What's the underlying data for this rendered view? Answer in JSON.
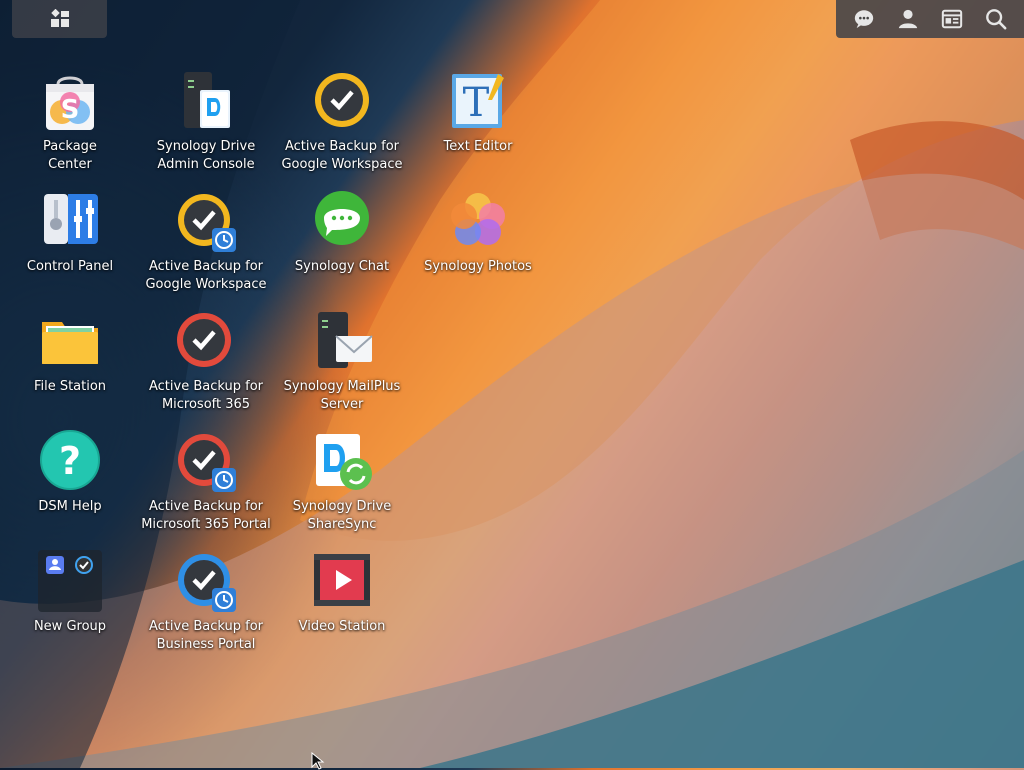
{
  "taskbar": {
    "main_menu_icon": "grid-icon",
    "tray": [
      {
        "name": "chat-icon"
      },
      {
        "name": "user-icon"
      },
      {
        "name": "widgets-icon"
      },
      {
        "name": "search-icon"
      }
    ]
  },
  "desktop": {
    "icons": [
      {
        "label": "Package\nCenter",
        "icon": "package-center-icon"
      },
      {
        "label": "Control Panel",
        "icon": "control-panel-icon"
      },
      {
        "label": "File Station",
        "icon": "file-station-icon"
      },
      {
        "label": "DSM Help",
        "icon": "dsm-help-icon"
      },
      {
        "label": "New Group",
        "icon": "new-group-icon"
      },
      {
        "label": "Synology Drive\nAdmin Console",
        "icon": "drive-admin-console-icon"
      },
      {
        "label": "Active Backup for\nGoogle Workspace",
        "icon": "active-backup-google-portal-icon"
      },
      {
        "label": "Active Backup for\nMicrosoft 365",
        "icon": "active-backup-m365-icon"
      },
      {
        "label": "Active Backup for\nMicrosoft 365 Portal",
        "icon": "active-backup-m365-portal-icon"
      },
      {
        "label": "Active Backup for\nBusiness Portal",
        "icon": "active-backup-business-portal-icon"
      },
      {
        "label": "Active Backup for\nGoogle Workspace",
        "icon": "active-backup-google-icon"
      },
      {
        "label": "Synology Chat",
        "icon": "synology-chat-icon"
      },
      {
        "label": "Synology MailPlus\nServer",
        "icon": "mailplus-server-icon"
      },
      {
        "label": "Synology Drive\nShareSync",
        "icon": "drive-sharesync-icon"
      },
      {
        "label": "Video Station",
        "icon": "video-station-icon"
      },
      {
        "label": "Text Editor",
        "icon": "text-editor-icon"
      },
      {
        "label": "Synology Photos",
        "icon": "synology-photos-icon"
      }
    ]
  },
  "colors": {
    "taskbar_bg": "#3c4048",
    "label_text": "#ffffff"
  }
}
